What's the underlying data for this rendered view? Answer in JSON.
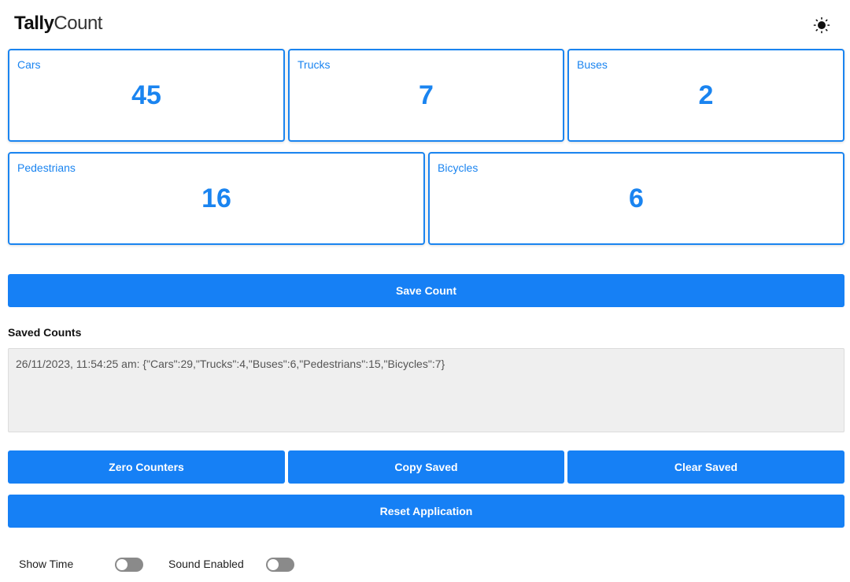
{
  "app": {
    "logo_bold": "Tally",
    "logo_light": "Count",
    "theme_icon": "sun-icon"
  },
  "counters": [
    {
      "label": "Cars",
      "value": "45"
    },
    {
      "label": "Trucks",
      "value": "7"
    },
    {
      "label": "Buses",
      "value": "2"
    },
    {
      "label": "Pedestrians",
      "value": "16"
    },
    {
      "label": "Bicycles",
      "value": "6"
    }
  ],
  "buttons": {
    "save_count": "Save Count",
    "zero_counters": "Zero Counters",
    "copy_saved": "Copy Saved",
    "clear_saved": "Clear Saved",
    "reset_application": "Reset Application"
  },
  "saved": {
    "title": "Saved Counts",
    "text": "26/11/2023, 11:54:25 am: {\"Cars\":29,\"Trucks\":4,\"Buses\":6,\"Pedestrians\":15,\"Bicycles\":7}"
  },
  "settings": {
    "show_time_label": "Show Time",
    "show_time_on": false,
    "sound_enabled_label": "Sound Enabled",
    "sound_enabled_on": false
  },
  "colors": {
    "accent": "#1680f5",
    "counter_text": "#1a84f0",
    "saved_bg": "#efefef",
    "toggle_off": "#8a8a8a"
  }
}
